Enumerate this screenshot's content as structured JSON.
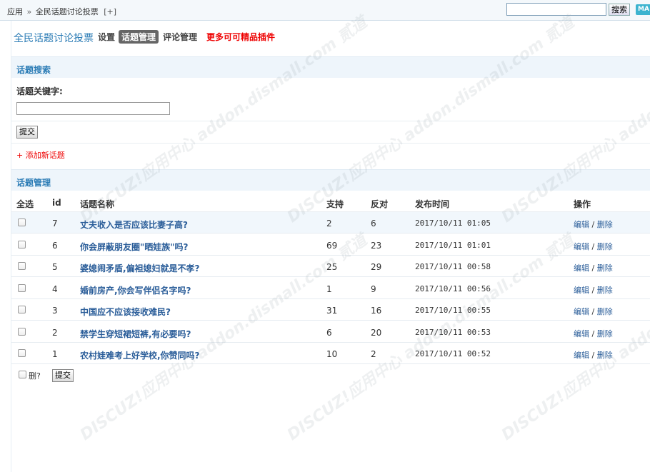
{
  "topbar": {
    "crumb_app": "应用",
    "crumb_sep": "»",
    "crumb_current": "全民话题讨论投票",
    "crumb_plus": "[+]",
    "search_value": "",
    "search_button": "搜索",
    "badge": "MA"
  },
  "plugin": {
    "title": "全民话题讨论投票",
    "nav_settings": "设置",
    "nav_topic_manage": "话题管理",
    "nav_comment_manage": "评论管理",
    "nav_more": "更多可可精品插件"
  },
  "search_section": {
    "header": "话题搜索",
    "keyword_label": "话题关键字:",
    "keyword_value": "",
    "submit": "提交",
    "add_link": "+ 添加新话题"
  },
  "manage_section": {
    "header": "话题管理",
    "columns": {
      "select_all": "全选",
      "id": "id",
      "title": "话题名称",
      "support": "支持",
      "oppose": "反对",
      "time": "发布时间",
      "ops": "操作"
    },
    "rows": [
      {
        "id": "7",
        "title": "丈夫收入是否应该比妻子高?",
        "support": "2",
        "oppose": "6",
        "time": "2017/10/11 01:05",
        "edit": "编辑",
        "sep": "/",
        "del": "删除"
      },
      {
        "id": "6",
        "title": "你会屏蔽朋友圈\"晒娃族\"吗?",
        "support": "69",
        "oppose": "23",
        "time": "2017/10/11 01:01",
        "edit": "编辑",
        "sep": "/",
        "del": "删除"
      },
      {
        "id": "5",
        "title": "婆媳闹矛盾,偏袒媳妇就是不孝?",
        "support": "25",
        "oppose": "29",
        "time": "2017/10/11 00:58",
        "edit": "编辑",
        "sep": "/",
        "del": "删除"
      },
      {
        "id": "4",
        "title": "婚前房产,你会写伴侣名字吗?",
        "support": "1",
        "oppose": "9",
        "time": "2017/10/11 00:56",
        "edit": "编辑",
        "sep": "/",
        "del": "删除"
      },
      {
        "id": "3",
        "title": "中国应不应该接收难民?",
        "support": "31",
        "oppose": "16",
        "time": "2017/10/11 00:55",
        "edit": "编辑",
        "sep": "/",
        "del": "删除"
      },
      {
        "id": "2",
        "title": "禁学生穿短裙短裤,有必要吗?",
        "support": "6",
        "oppose": "20",
        "time": "2017/10/11 00:53",
        "edit": "编辑",
        "sep": "/",
        "del": "删除"
      },
      {
        "id": "1",
        "title": "农村娃难考上好学校,你赞同吗?",
        "support": "10",
        "oppose": "2",
        "time": "2017/10/11 00:52",
        "edit": "编辑",
        "sep": "/",
        "del": "删除"
      }
    ],
    "delete_label": "删?",
    "submit": "提交"
  },
  "watermark": "DISCUZ!应用中心 addon.dismall.com 贰道"
}
